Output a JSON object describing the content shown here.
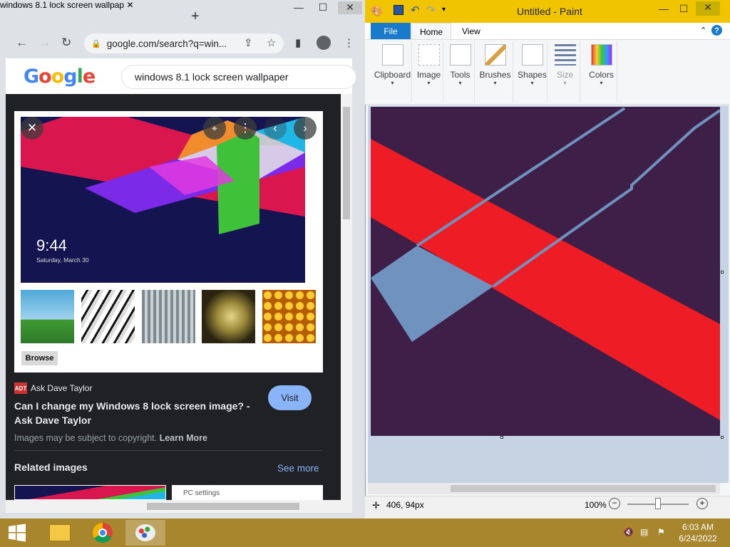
{
  "chrome": {
    "tab_title": "windows 8.1 lock screen wallpap",
    "url": "google.com/search?q=win...",
    "search_query": "windows 8.1 lock screen wallpaper",
    "image_time": "9:44",
    "image_date": "Saturday, March 30",
    "browse_label": "Browse",
    "source_badge": "ADT",
    "source_name": "Ask Dave Taylor",
    "result_title": "Can I change my Windows 8 lock screen image? - Ask Dave Taylor",
    "visit_label": "Visit",
    "copyright_text": "Images may be subject to copyright.",
    "learn_more": "Learn More",
    "related_heading": "Related images",
    "see_more": "See more",
    "related_thumb_text": "PC settings"
  },
  "paint": {
    "title": "Untitled - Paint",
    "tabs": [
      "File",
      "Home",
      "View"
    ],
    "ribbon_groups": [
      "Clipboard",
      "Image",
      "Tools",
      "Brushes",
      "Shapes",
      "Size",
      "Colors"
    ],
    "cursor_pos": "406, 94px",
    "zoom": "100%"
  },
  "taskbar": {
    "time": "6:03 AM",
    "date": "6/24/2022"
  },
  "colors": {
    "paint_title_bar": "#f0c500",
    "canvas_bg": "#3e1f47",
    "canvas_red": "#ee1c24",
    "canvas_blue": "#7092be",
    "taskbar": "#a8862d",
    "file_tab": "#1979ca"
  }
}
